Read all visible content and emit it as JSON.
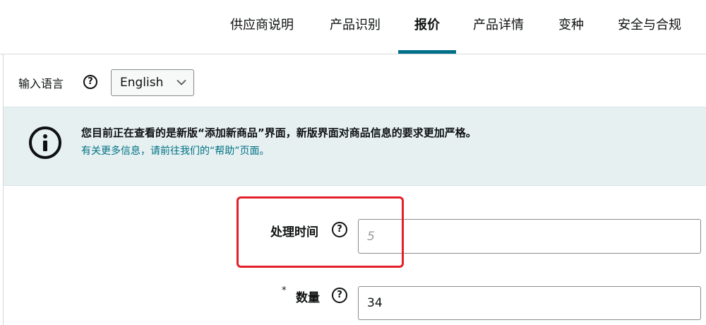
{
  "tabs": [
    {
      "label": "供应商说明"
    },
    {
      "label": "产品识别"
    },
    {
      "label": "报价"
    },
    {
      "label": "产品详情"
    },
    {
      "label": "变种"
    },
    {
      "label": "安全与合规"
    }
  ],
  "active_tab": "报价",
  "language": {
    "label": "输入语言",
    "selected": "English"
  },
  "banner": {
    "title": "您目前正在查看的是新版“添加新商品”界面，新版界面对商品信息的要求更加严格。",
    "link": "有关更多信息，请前往我们的“帮助”页面。"
  },
  "fields": {
    "handling_time": {
      "label": "处理时间",
      "placeholder": "5",
      "value": ""
    },
    "quantity": {
      "label": "数量",
      "required_mark": "*",
      "value": "34"
    }
  },
  "colors": {
    "accent": "#00708a",
    "link": "#007185",
    "banner_bg": "#e6f0f1",
    "highlight": "#e3202a"
  }
}
